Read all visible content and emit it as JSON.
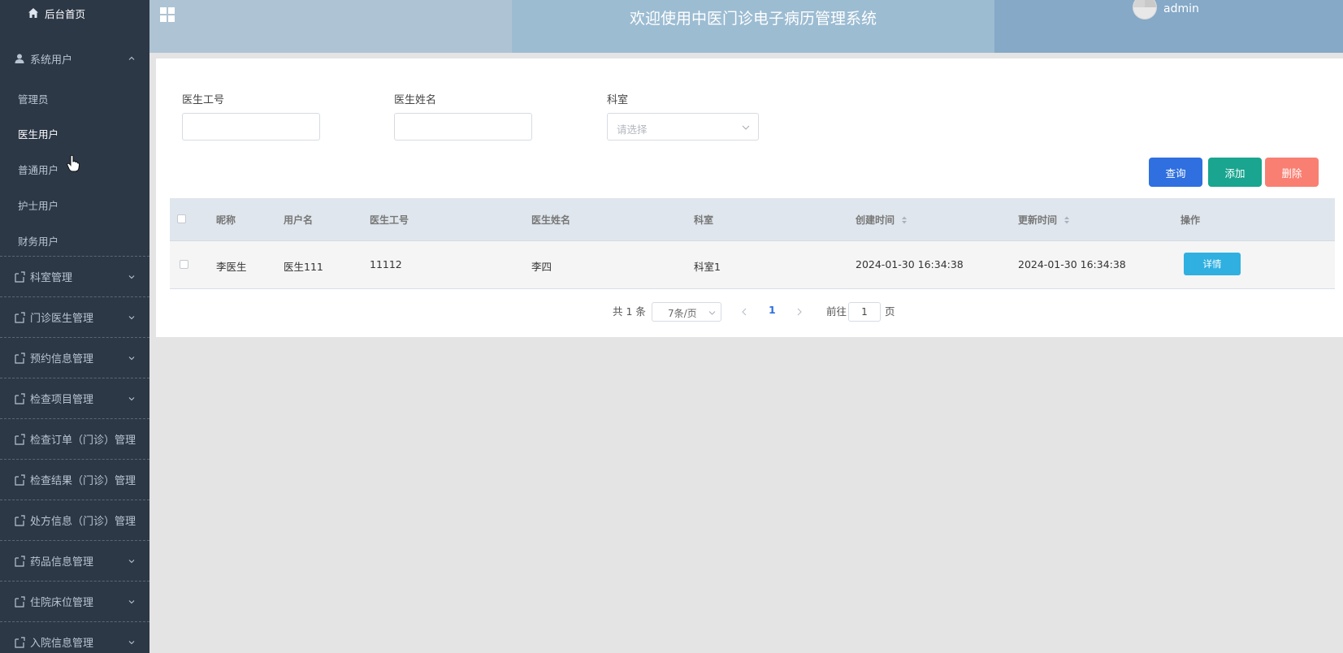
{
  "sidebar": {
    "home": "后台首页",
    "system_users": "系统用户",
    "sub_items": [
      "管理员",
      "医生用户",
      "普通用户",
      "护士用户",
      "财务用户"
    ],
    "groups": [
      "科室管理",
      "门诊医生管理",
      "预约信息管理",
      "检查项目管理",
      "检查订单（门诊）管理",
      "检查结果（门诊）管理",
      "处方信息（门诊）管理",
      "药品信息管理",
      "住院床位管理",
      "入院信息管理"
    ]
  },
  "header": {
    "title": "欢迎使用中医门诊电子病历管理系统",
    "username": "admin"
  },
  "filters": {
    "doctor_id_label": "医生工号",
    "doctor_name_label": "医生姓名",
    "department_label": "科室",
    "department_placeholder": "请选择"
  },
  "actions": {
    "query": "查询",
    "add": "添加",
    "delete": "删除"
  },
  "table": {
    "headers": [
      "昵称",
      "用户名",
      "医生工号",
      "医生姓名",
      "科室",
      "创建时间",
      "更新时间",
      "操作"
    ],
    "rows": [
      {
        "nickname": "李医生",
        "username": "医生111",
        "doctor_id": "11112",
        "doctor_name": "李四",
        "department": "科室1",
        "created": "2024-01-30 16:34:38",
        "updated": "2024-01-30 16:34:38",
        "action": "详情"
      }
    ]
  },
  "pagination": {
    "total": "共 1 条",
    "page_size": "7条/页",
    "current_page": "1",
    "goto_label": "前往",
    "goto_value": "1",
    "page_suffix": "页"
  },
  "colors": {
    "sidebar_bg": "#2d3847",
    "primary": "#2f6fe0",
    "success": "#19a58f",
    "danger": "#f97f72",
    "info": "#2fb0e0"
  }
}
